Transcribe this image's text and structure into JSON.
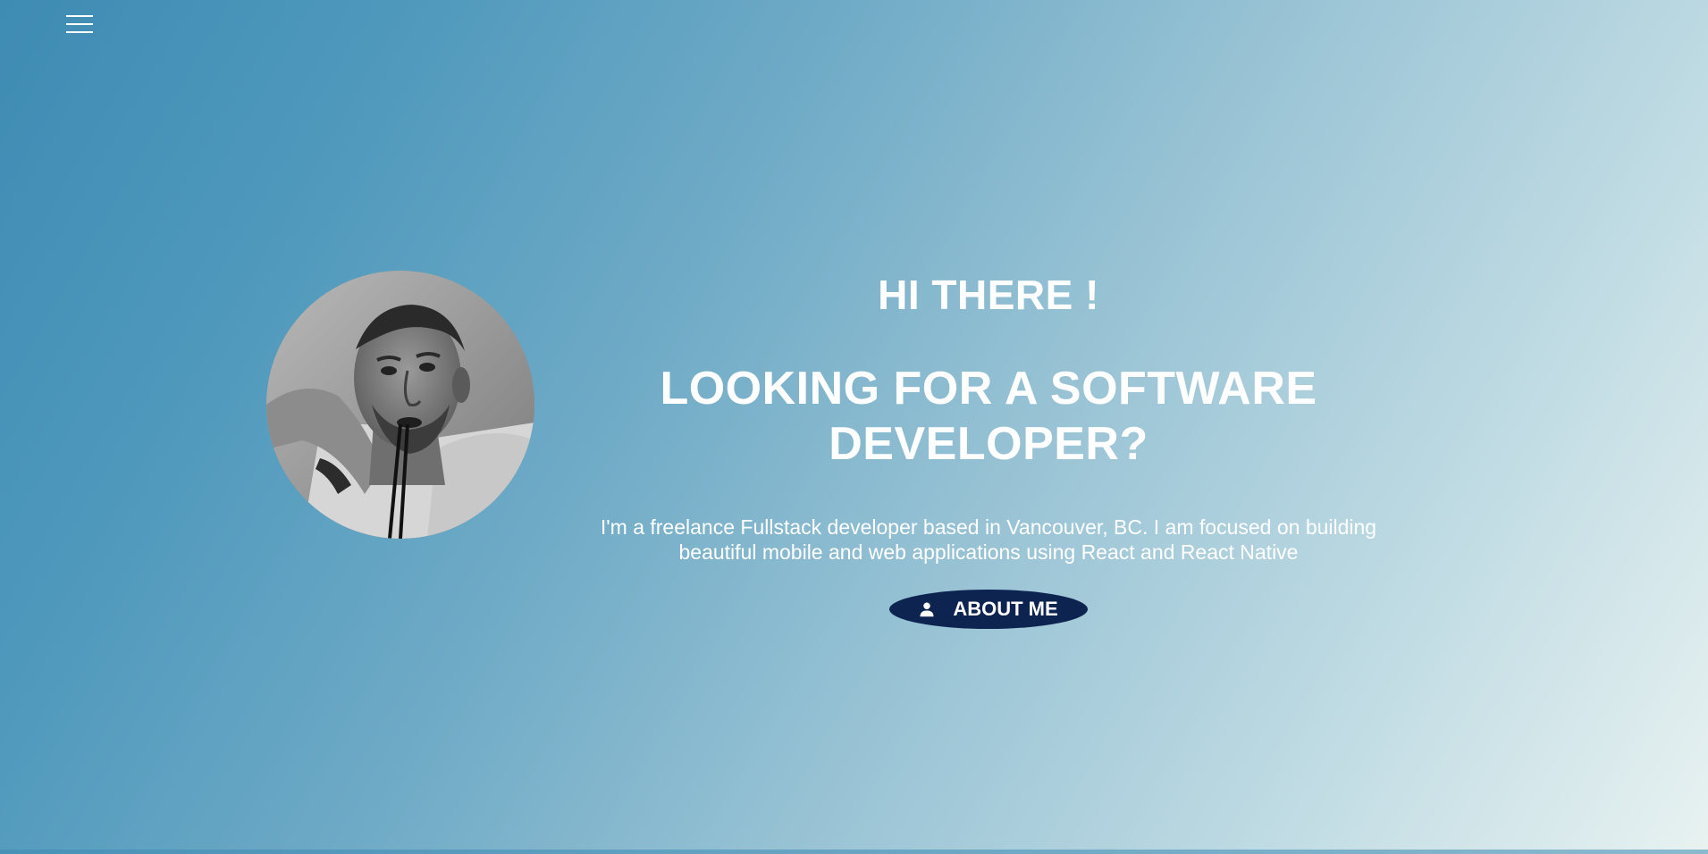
{
  "nav": {
    "menu_icon": "hamburger-menu-icon"
  },
  "profile": {
    "photo": "portrait-photo"
  },
  "hero": {
    "greeting": "HI THERE !",
    "headline": "LOOKING FOR A SOFTWARE DEVELOPER?",
    "description": "I'm a freelance Fullstack developer based in Vancouver, BC. I am focused on building beautiful mobile and web applications using React and React Native",
    "cta": {
      "label": "ABOUT ME",
      "icon": "person-icon"
    }
  },
  "colors": {
    "button_bg": "#0d2350",
    "text": "#ffffff",
    "gradient_start": "#3e8bb3",
    "gradient_end": "#e8f2f1"
  }
}
